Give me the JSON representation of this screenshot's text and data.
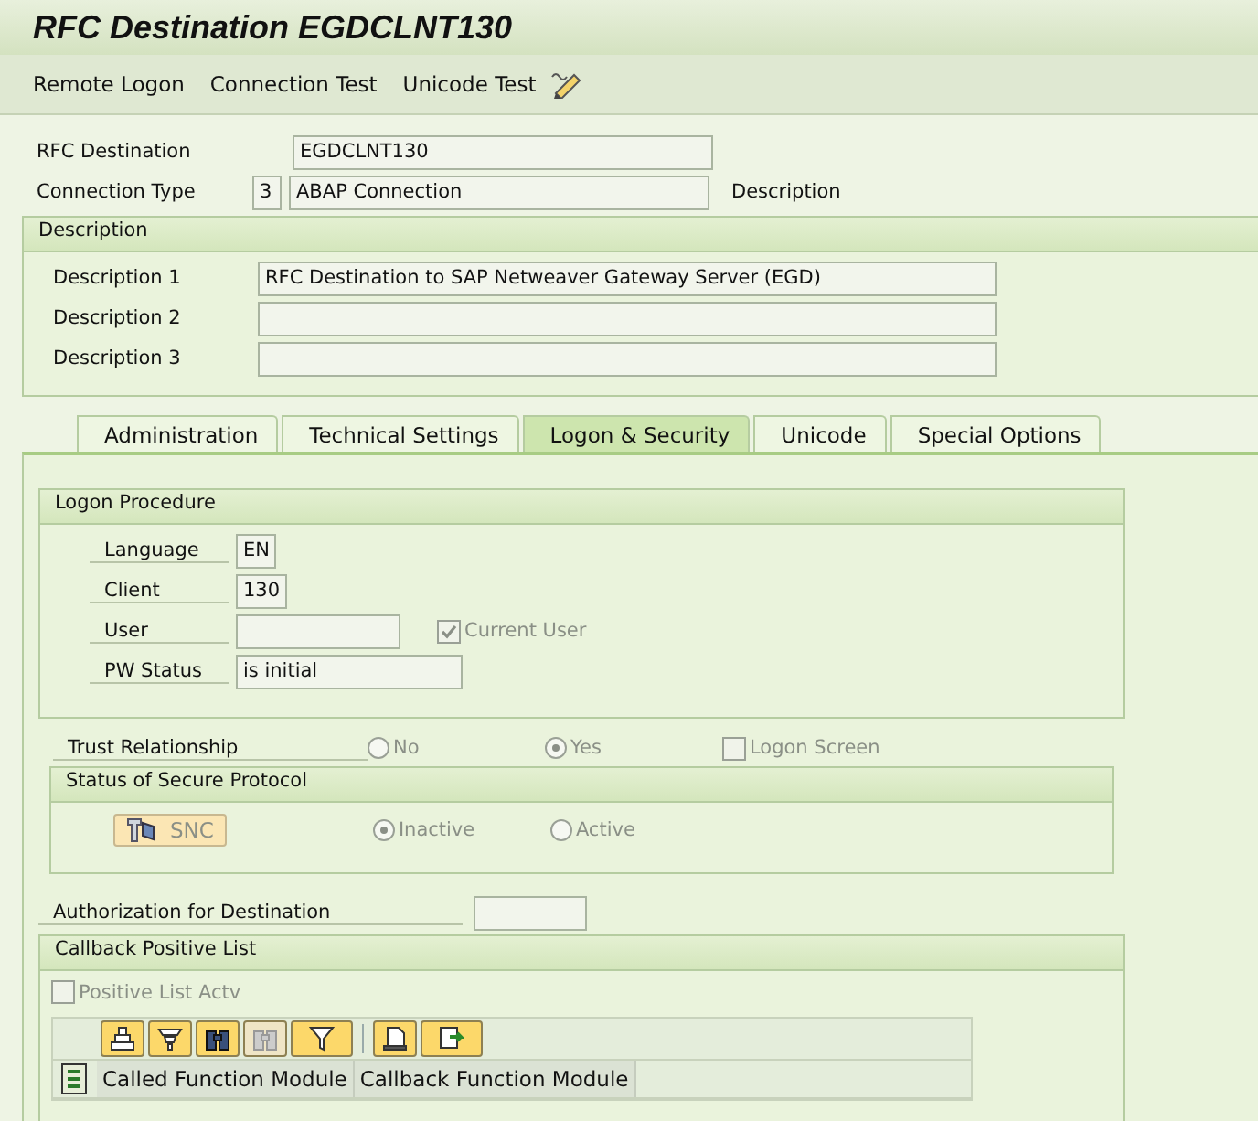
{
  "window": {
    "title": "RFC Destination EGDCLNT130"
  },
  "toolbar": {
    "buttons": [
      "Remote Logon",
      "Connection Test",
      "Unicode Test"
    ]
  },
  "rfc_destination": {
    "label": "RFC Destination",
    "value": "EGDCLNT130"
  },
  "connection_type": {
    "label": "Connection Type",
    "code": "3",
    "value": "ABAP Connection",
    "description_label": "Description"
  },
  "description_group": {
    "title": "Description",
    "fields": [
      {
        "label": "Description 1",
        "value": "RFC Destination to SAP Netweaver Gateway Server (EGD)"
      },
      {
        "label": "Description 2"
      },
      {
        "label": "Description 3"
      }
    ]
  },
  "tabs": [
    {
      "label": "Administration",
      "selected": false
    },
    {
      "label": "Technical Settings",
      "selected": false
    },
    {
      "label": "Logon & Security",
      "selected": true
    },
    {
      "label": "Unicode",
      "selected": false
    },
    {
      "label": "Special Options",
      "selected": false
    }
  ],
  "logon_procedure": {
    "title": "Logon Procedure",
    "fields": [
      {
        "label": "Language",
        "value": "EN"
      },
      {
        "label": "Client",
        "value": "130"
      },
      {
        "label": "User"
      },
      {
        "label": "PW Status",
        "value": "is initial"
      }
    ],
    "current_user": {
      "label": "Current User",
      "checked": true,
      "disabled": true
    }
  },
  "trust_relationship": {
    "label": "Trust Relationship",
    "options": [
      {
        "label": "No",
        "selected": false
      },
      {
        "label": "Yes",
        "selected": true
      }
    ],
    "logon_screen": {
      "label": "Logon Screen",
      "checked": false,
      "disabled": true
    }
  },
  "secure_protocol": {
    "title": "Status of Secure Protocol",
    "button": "SNC",
    "options": [
      {
        "label": "Inactive",
        "selected": true
      },
      {
        "label": "Active",
        "selected": false
      }
    ]
  },
  "authorization": {
    "label": "Authorization for Destination"
  },
  "callback": {
    "title": "Callback Positive List",
    "checkbox": {
      "label": "Positive List Actv",
      "checked": false,
      "disabled": true
    },
    "columns": [
      "Called Function Module",
      "Callback Function Module"
    ]
  }
}
